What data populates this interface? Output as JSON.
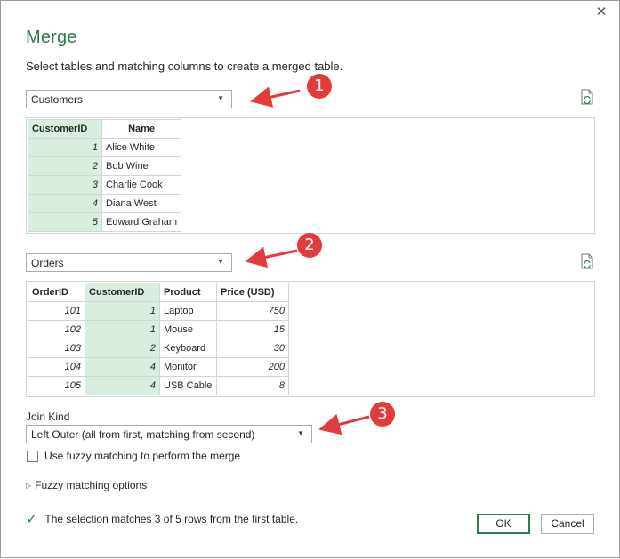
{
  "dialog": {
    "close_glyph": "✕",
    "title": "Merge",
    "subtitle": "Select tables and matching columns to create a merged table."
  },
  "first_table": {
    "selected": "Customers",
    "columns": [
      "CustomerID",
      "Name"
    ],
    "rows": [
      [
        "1",
        "Alice White"
      ],
      [
        "2",
        "Bob Wine"
      ],
      [
        "3",
        "Charlie Cook"
      ],
      [
        "4",
        "Diana West"
      ],
      [
        "5",
        "Edward Graham"
      ]
    ],
    "selected_column": "CustomerID"
  },
  "second_table": {
    "selected": "Orders",
    "columns": [
      "OrderID",
      "CustomerID",
      "Product",
      "Price (USD)"
    ],
    "rows": [
      [
        "101",
        "1",
        "Laptop",
        "750"
      ],
      [
        "102",
        "1",
        "Mouse",
        "15"
      ],
      [
        "103",
        "2",
        "Keyboard",
        "30"
      ],
      [
        "104",
        "4",
        "Monitor",
        "200"
      ],
      [
        "105",
        "4",
        "USB Cable",
        "8"
      ]
    ],
    "selected_column": "CustomerID"
  },
  "join": {
    "label": "Join Kind",
    "selected": "Left Outer (all from first, matching from second)"
  },
  "fuzzy": {
    "checkbox_label": "Use fuzzy matching to perform the merge",
    "checked": false,
    "options_label": "Fuzzy matching options"
  },
  "status": {
    "text": "The selection matches 3 of 5 rows from the first table."
  },
  "buttons": {
    "ok": "OK",
    "cancel": "Cancel"
  },
  "callouts": [
    "1",
    "2",
    "3"
  ],
  "colors": {
    "accent_green": "#2b7d4c",
    "selected_column_bg": "#d8efe0",
    "callout_red": "#e23b3b"
  }
}
